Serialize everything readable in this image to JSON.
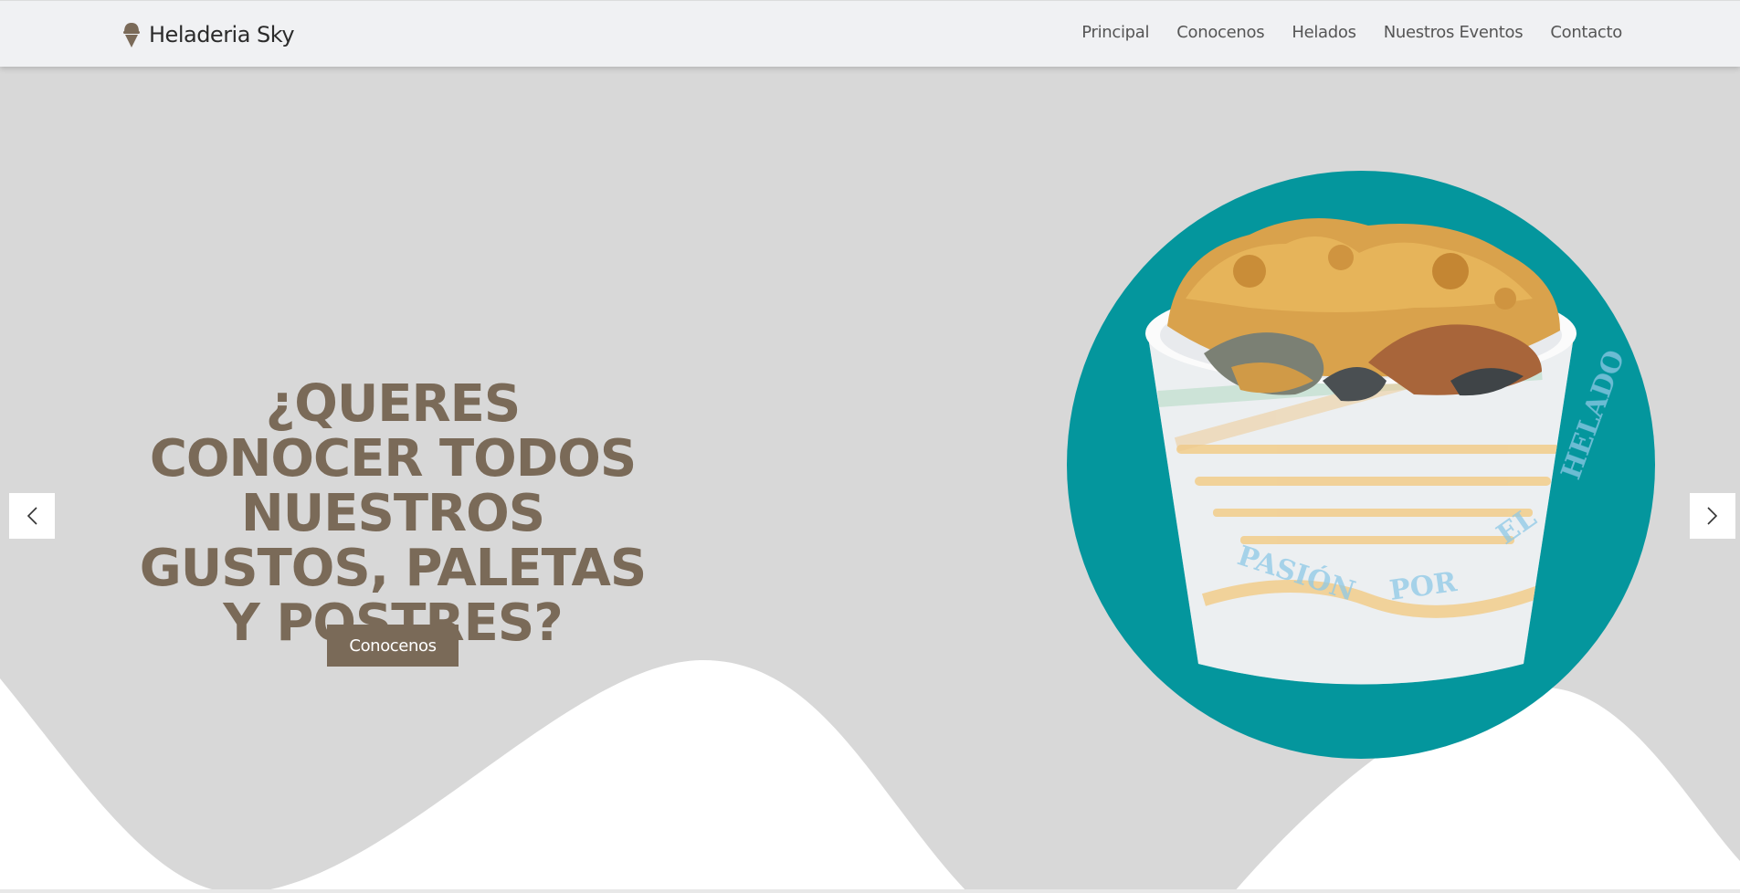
{
  "brand": {
    "name": "Heladeria Sky",
    "icon": "ice-cream-icon"
  },
  "nav": {
    "items": [
      {
        "label": "Principal"
      },
      {
        "label": "Conocenos"
      },
      {
        "label": "Helados"
      },
      {
        "label": "Nuestros Eventos"
      },
      {
        "label": "Contacto"
      }
    ]
  },
  "hero": {
    "headline": "¿QUERES CONOCER TODOS NUESTROS GUSTOS, PALETAS Y POSTRES?",
    "cta_label": "Conocenos",
    "image": {
      "description_icon": "ice-cream-cup-image",
      "watermark_words": [
        "Pasión",
        "por",
        "el",
        "Helado"
      ]
    }
  },
  "carousel": {
    "prev_icon": "chevron-left-icon",
    "next_icon": "chevron-right-icon"
  },
  "colors": {
    "accent": "#7a6a58",
    "hero_background": "#d8d8d8",
    "circle": "#04969d",
    "navbar": "#f0f1f3"
  }
}
